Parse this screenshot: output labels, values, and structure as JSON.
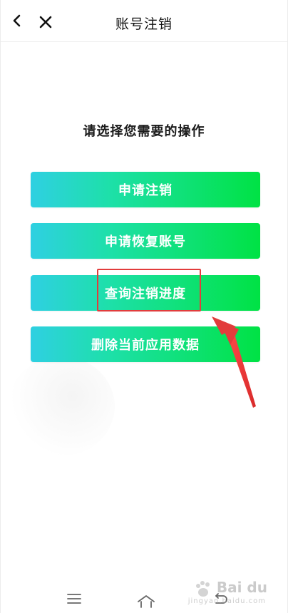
{
  "header": {
    "title": "账号注销"
  },
  "prompt": {
    "text": "请选择您需要的操作"
  },
  "actions": [
    {
      "label": "申请注销"
    },
    {
      "label": "申请恢复账号"
    },
    {
      "label": "查询注销进度"
    },
    {
      "label": "删除当前应用数据"
    }
  ],
  "annotation": {
    "highlight_target": "查询注销进度",
    "color": "#e23c3c"
  },
  "theme": {
    "button_gradient_start": "#2fd0e2",
    "button_gradient_end": "#00e244",
    "text_primary": "#111111"
  },
  "watermark": {
    "brand": "Bai du",
    "sub": "jingyan.baidu.com"
  },
  "icons": {
    "back": "chevron-left-icon",
    "close": "close-icon",
    "menu": "menu-icon",
    "home": "home-icon",
    "nav_back": "return-icon"
  }
}
